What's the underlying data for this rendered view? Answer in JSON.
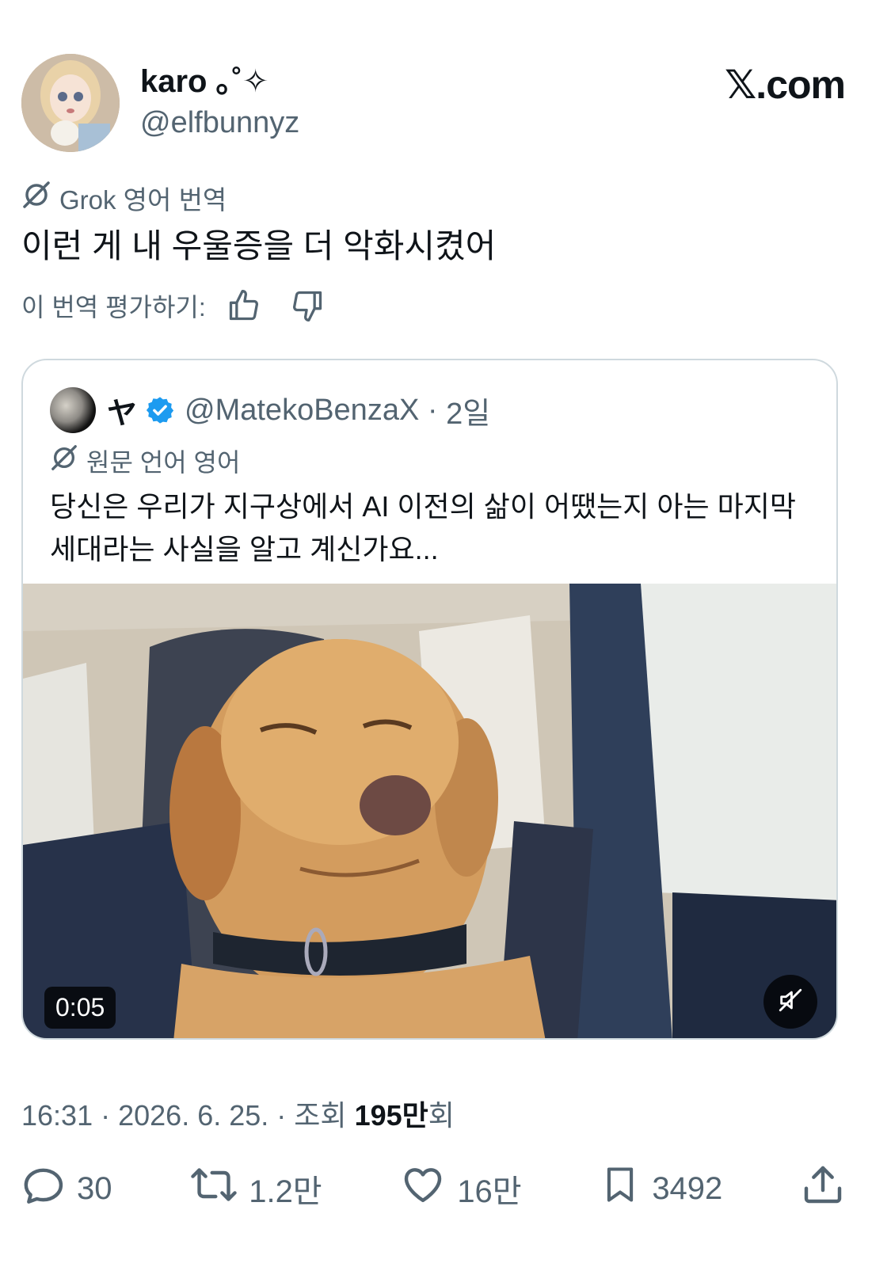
{
  "author": {
    "display_name": "karo ｡˚✧",
    "handle": "@elfbunnyz"
  },
  "site_label": "𝕏.com",
  "translation": {
    "label": "Grok 영어 번역",
    "text": "이런 게 내 우울증을 더 악화시켰어",
    "rate_label": "이 번역 평가하기:",
    "thumbs_up_icon": "thumbs-up-icon",
    "thumbs_down_icon": "thumbs-down-icon"
  },
  "quote": {
    "name": "ヤ",
    "handle": "@MatekoBenzaX",
    "time": "2일",
    "original_language_label": "원문 언어 영어",
    "text": "당신은 우리가 지구상에서 AI 이전의 삶이 어땠는지 아는 마지막 세대라는 사실을 알고 계신가요...",
    "video": {
      "duration": "0:05",
      "muted": true
    }
  },
  "meta": {
    "time": "16:31",
    "date": "2026. 6. 25.",
    "views_prefix": "조회",
    "views_number": "195",
    "views_unit": "만",
    "views_suffix": "회"
  },
  "actions": {
    "replies": "30",
    "reposts": "1.2만",
    "likes": "16만",
    "bookmarks": "3492"
  },
  "colors": {
    "text": "#0f1419",
    "secondary": "#536471",
    "border": "#cfd9de",
    "verified": "#1d9bf0"
  }
}
